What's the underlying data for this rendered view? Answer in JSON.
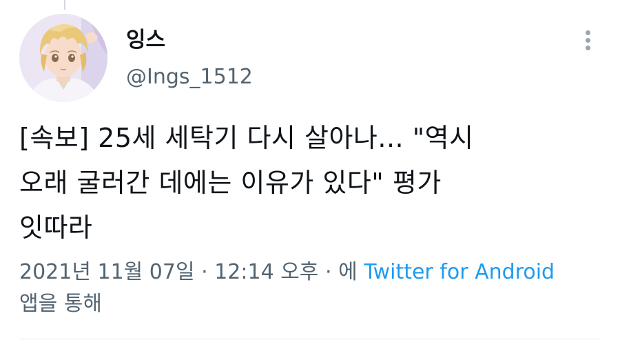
{
  "user": {
    "display_name": "잉스",
    "handle": "@Ings_1512"
  },
  "tweet": {
    "lines": [
      "[속보] 25세 세탁기 다시 살아나... \"역시",
      "오래 굴러간 데에는 이유가 있다\" 평가",
      "잇따라"
    ]
  },
  "meta": {
    "date": "2021년 11월 07일",
    "separator": "·",
    "time": "12:14 오후",
    "via_prefix": "에",
    "source": "Twitter for Android",
    "via_suffix": "앱을 통해"
  },
  "colors": {
    "text": "#0f1419",
    "secondary": "#536471",
    "link": "#1d9bf0"
  },
  "icons": {
    "more": "more-vertical-icon",
    "avatar": "anime-boy-avatar"
  }
}
